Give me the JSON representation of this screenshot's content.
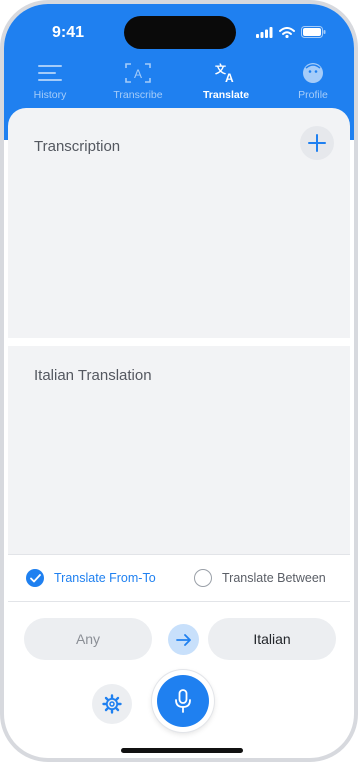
{
  "status": {
    "time": "9:41"
  },
  "tabs": [
    {
      "label": "History",
      "icon": "menu-icon"
    },
    {
      "label": "Transcribe",
      "icon": "text-scan-icon"
    },
    {
      "label": "Translate",
      "icon": "translate-icon",
      "active": true
    },
    {
      "label": "Profile",
      "icon": "profile-icon"
    }
  ],
  "transcription": {
    "title": "Transcription"
  },
  "translation": {
    "title": "Italian Translation"
  },
  "modes": {
    "from_to": {
      "label": "Translate From-To",
      "selected": true
    },
    "between": {
      "label": "Translate Between",
      "selected": false
    }
  },
  "languages": {
    "source": "Any",
    "target": "Italian"
  },
  "colors": {
    "accent": "#1f80f0",
    "panel": "#f2f3f5"
  }
}
